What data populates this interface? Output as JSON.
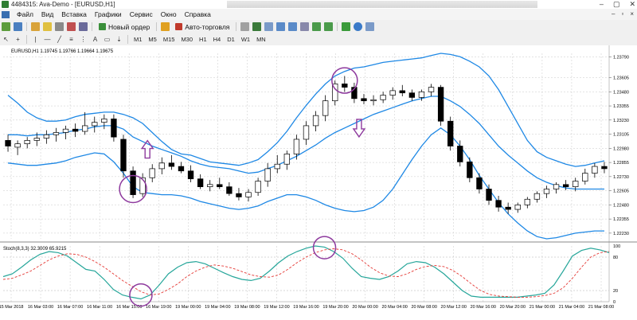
{
  "window": {
    "title": "4484315: Ava-Demo - [EURUSD,H1]",
    "controls": [
      "–",
      "▢",
      "✕"
    ]
  },
  "menu": {
    "items": [
      "Файл",
      "Вид",
      "Вставка",
      "Графики",
      "Сервис",
      "Окно",
      "Справка"
    ],
    "mdi_controls": [
      "–",
      "▫",
      "×"
    ]
  },
  "toolbar": {
    "new_order_label": "Новый ордер",
    "autotrade_label": "Авто-торговля",
    "icons": [
      "new-chart-icon",
      "profiles-icon",
      "market-watch-icon",
      "data-window-icon",
      "navigator-icon",
      "terminal-icon",
      "tester-icon",
      "metaeditor-icon",
      "bar-chart-icon",
      "candlestick-icon",
      "line-chart-icon",
      "zoom-in-icon",
      "zoom-out-icon",
      "tile-icon",
      "autoscroll-icon",
      "chart-shift-icon",
      "indicators-icon",
      "periods-icon",
      "templates-icon",
      "cursor-icon",
      "crosshair-icon",
      "vertical-line-icon",
      "horizontal-line-icon",
      "trendline-icon",
      "equidistant-channel-icon",
      "fibonacci-icon",
      "text-icon",
      "text-label-icon",
      "arrows-icon"
    ],
    "timeframes": [
      "M1",
      "M5",
      "M15",
      "M30",
      "H1",
      "H4",
      "D1",
      "W1",
      "MN"
    ],
    "active_timeframe": "H1"
  },
  "chart": {
    "header": "EURUSD,H1  1.19745 1.19766 1.19664 1.19675",
    "indicator_label": "Stoch(8,3,3) 32.3009 65.9215",
    "colors": {
      "bull": "#ffffff",
      "bear": "#000000",
      "bands": "#1e88e5",
      "stoch_main": "#26a69a",
      "stoch_signal": "#e53935",
      "annotation": "#8e3a9e",
      "grid": "#c8c8c8"
    }
  },
  "chart_data": {
    "type": "candlestick",
    "symbol": "EURUSD",
    "timeframe": "H1",
    "price_axis_ticks": [
      "1.23790",
      "1.23605",
      "1.23480",
      "1.23355",
      "1.23230",
      "1.23105",
      "1.22980",
      "1.22855",
      "1.22730",
      "1.22605",
      "1.22480",
      "1.22355",
      "1.22230"
    ],
    "ylim": [
      1.2218,
      1.2382
    ],
    "stoch_axis_ticks": [
      "100",
      "80",
      "20",
      "0"
    ],
    "time_axis_labels": [
      "15 Mar 2018",
      "16 Mar 03:00",
      "16 Mar 07:00",
      "16 Mar 11:00",
      "16 Mar 15:00",
      "16 Mar 19:00",
      "19 Mar 00:00",
      "19 Mar 04:00",
      "19 Mar 08:00",
      "19 Mar 12:00",
      "19 Mar 16:00",
      "19 Mar 20:00",
      "20 Mar 00:00",
      "20 Mar 04:00",
      "20 Mar 08:00",
      "20 Mar 12:00",
      "20 Mar 16:00",
      "20 Mar 20:00",
      "21 Mar 00:00",
      "21 Mar 04:00",
      "21 Mar 08:00"
    ],
    "candles": [
      {
        "o": 1.2305,
        "h": 1.231,
        "l": 1.2295,
        "c": 1.23
      },
      {
        "o": 1.2299,
        "h": 1.2305,
        "l": 1.2292,
        "c": 1.2302
      },
      {
        "o": 1.2302,
        "h": 1.2308,
        "l": 1.2298,
        "c": 1.2305
      },
      {
        "o": 1.2305,
        "h": 1.2312,
        "l": 1.23,
        "c": 1.2307
      },
      {
        "o": 1.2307,
        "h": 1.2314,
        "l": 1.2302,
        "c": 1.231
      },
      {
        "o": 1.231,
        "h": 1.2316,
        "l": 1.2304,
        "c": 1.2312
      },
      {
        "o": 1.2312,
        "h": 1.2318,
        "l": 1.2306,
        "c": 1.2315
      },
      {
        "o": 1.2315,
        "h": 1.232,
        "l": 1.2308,
        "c": 1.2313
      },
      {
        "o": 1.2313,
        "h": 1.233,
        "l": 1.231,
        "c": 1.2318
      },
      {
        "o": 1.2318,
        "h": 1.2326,
        "l": 1.2312,
        "c": 1.2321
      },
      {
        "o": 1.2321,
        "h": 1.2328,
        "l": 1.2315,
        "c": 1.2324
      },
      {
        "o": 1.2324,
        "h": 1.2328,
        "l": 1.2304,
        "c": 1.2308
      },
      {
        "o": 1.2306,
        "h": 1.231,
        "l": 1.2272,
        "c": 1.2278
      },
      {
        "o": 1.2278,
        "h": 1.2282,
        "l": 1.2254,
        "c": 1.2257
      },
      {
        "o": 1.2258,
        "h": 1.2276,
        "l": 1.2255,
        "c": 1.2272
      },
      {
        "o": 1.2272,
        "h": 1.2284,
        "l": 1.2268,
        "c": 1.228
      },
      {
        "o": 1.228,
        "h": 1.229,
        "l": 1.2275,
        "c": 1.2285
      },
      {
        "o": 1.2285,
        "h": 1.2292,
        "l": 1.2279,
        "c": 1.2282
      },
      {
        "o": 1.2282,
        "h": 1.2286,
        "l": 1.2276,
        "c": 1.2278
      },
      {
        "o": 1.2278,
        "h": 1.2283,
        "l": 1.2268,
        "c": 1.2271
      },
      {
        "o": 1.2271,
        "h": 1.2275,
        "l": 1.2262,
        "c": 1.2264
      },
      {
        "o": 1.2264,
        "h": 1.227,
        "l": 1.226,
        "c": 1.2266
      },
      {
        "o": 1.2266,
        "h": 1.2272,
        "l": 1.2262,
        "c": 1.2264
      },
      {
        "o": 1.2264,
        "h": 1.2268,
        "l": 1.2256,
        "c": 1.2258
      },
      {
        "o": 1.2258,
        "h": 1.2263,
        "l": 1.2252,
        "c": 1.2255
      },
      {
        "o": 1.2255,
        "h": 1.2262,
        "l": 1.2251,
        "c": 1.2259
      },
      {
        "o": 1.2259,
        "h": 1.2272,
        "l": 1.2256,
        "c": 1.2269
      },
      {
        "o": 1.2269,
        "h": 1.2285,
        "l": 1.2264,
        "c": 1.228
      },
      {
        "o": 1.228,
        "h": 1.2292,
        "l": 1.2276,
        "c": 1.2284
      },
      {
        "o": 1.2284,
        "h": 1.2296,
        "l": 1.2279,
        "c": 1.2293
      },
      {
        "o": 1.2293,
        "h": 1.231,
        "l": 1.2288,
        "c": 1.2306
      },
      {
        "o": 1.2306,
        "h": 1.2322,
        "l": 1.2301,
        "c": 1.2318
      },
      {
        "o": 1.2318,
        "h": 1.2331,
        "l": 1.2313,
        "c": 1.2327
      },
      {
        "o": 1.2327,
        "h": 1.2345,
        "l": 1.2322,
        "c": 1.234
      },
      {
        "o": 1.234,
        "h": 1.2358,
        "l": 1.2336,
        "c": 1.2355
      },
      {
        "o": 1.2355,
        "h": 1.2362,
        "l": 1.2348,
        "c": 1.2352
      },
      {
        "o": 1.2352,
        "h": 1.2356,
        "l": 1.2338,
        "c": 1.2342
      },
      {
        "o": 1.2342,
        "h": 1.2346,
        "l": 1.2337,
        "c": 1.234
      },
      {
        "o": 1.234,
        "h": 1.2345,
        "l": 1.2336,
        "c": 1.2341
      },
      {
        "o": 1.2341,
        "h": 1.2348,
        "l": 1.2338,
        "c": 1.2345
      },
      {
        "o": 1.2345,
        "h": 1.2352,
        "l": 1.2341,
        "c": 1.2349
      },
      {
        "o": 1.2349,
        "h": 1.2354,
        "l": 1.2344,
        "c": 1.2347
      },
      {
        "o": 1.2347,
        "h": 1.235,
        "l": 1.234,
        "c": 1.2343
      },
      {
        "o": 1.2343,
        "h": 1.235,
        "l": 1.234,
        "c": 1.2348
      },
      {
        "o": 1.2348,
        "h": 1.2355,
        "l": 1.2344,
        "c": 1.2352
      },
      {
        "o": 1.2352,
        "h": 1.2354,
        "l": 1.2318,
        "c": 1.2322
      },
      {
        "o": 1.2322,
        "h": 1.2326,
        "l": 1.2296,
        "c": 1.23
      },
      {
        "o": 1.23,
        "h": 1.2305,
        "l": 1.2282,
        "c": 1.2286
      },
      {
        "o": 1.2286,
        "h": 1.229,
        "l": 1.2268,
        "c": 1.2272
      },
      {
        "o": 1.2272,
        "h": 1.2276,
        "l": 1.2258,
        "c": 1.2262
      },
      {
        "o": 1.2262,
        "h": 1.2266,
        "l": 1.2248,
        "c": 1.2252
      },
      {
        "o": 1.2252,
        "h": 1.2256,
        "l": 1.2242,
        "c": 1.2246
      },
      {
        "o": 1.2246,
        "h": 1.225,
        "l": 1.224,
        "c": 1.2244
      },
      {
        "o": 1.2244,
        "h": 1.225,
        "l": 1.2241,
        "c": 1.2248
      },
      {
        "o": 1.2248,
        "h": 1.2255,
        "l": 1.2245,
        "c": 1.2253
      },
      {
        "o": 1.2253,
        "h": 1.226,
        "l": 1.225,
        "c": 1.2258
      },
      {
        "o": 1.2258,
        "h": 1.2265,
        "l": 1.2254,
        "c": 1.2262
      },
      {
        "o": 1.2262,
        "h": 1.2268,
        "l": 1.2258,
        "c": 1.2266
      },
      {
        "o": 1.2266,
        "h": 1.227,
        "l": 1.2261,
        "c": 1.2264
      },
      {
        "o": 1.2264,
        "h": 1.2272,
        "l": 1.226,
        "c": 1.2269
      },
      {
        "o": 1.2269,
        "h": 1.228,
        "l": 1.2266,
        "c": 1.2276
      },
      {
        "o": 1.2276,
        "h": 1.2285,
        "l": 1.2272,
        "c": 1.2282
      },
      {
        "o": 1.2282,
        "h": 1.2286,
        "l": 1.2276,
        "c": 1.228
      }
    ],
    "bollinger": {
      "upper": [
        1.2345,
        1.2338,
        1.233,
        1.2325,
        1.2322,
        1.2322,
        1.2323,
        1.2326,
        1.2328,
        1.2329,
        1.233,
        1.233,
        1.2328,
        1.2325,
        1.232,
        1.2312,
        1.2304,
        1.2297,
        1.2293,
        1.2292,
        1.2289,
        1.2286,
        1.2285,
        1.2284,
        1.2283,
        1.2285,
        1.2288,
        1.2295,
        1.2303,
        1.2313,
        1.2325,
        1.2336,
        1.2346,
        1.2355,
        1.2362,
        1.2366,
        1.2369,
        1.237,
        1.2372,
        1.2374,
        1.2375,
        1.2376,
        1.2377,
        1.2378,
        1.238,
        1.2382,
        1.2381,
        1.2379,
        1.2375,
        1.237,
        1.2362,
        1.235,
        1.2335,
        1.232,
        1.2305,
        1.2295,
        1.229,
        1.2287,
        1.2284,
        1.2282,
        1.2283,
        1.2285,
        1.2287
      ],
      "middle": [
        1.231,
        1.231,
        1.2309,
        1.231,
        1.231,
        1.2311,
        1.2312,
        1.2314,
        1.2315,
        1.2317,
        1.2318,
        1.2318,
        1.2315,
        1.2308,
        1.2304,
        1.23,
        1.2297,
        1.2294,
        1.2291,
        1.2287,
        1.2284,
        1.2282,
        1.2281,
        1.228,
        1.2278,
        1.2276,
        1.2277,
        1.228,
        1.2283,
        1.2287,
        1.2291,
        1.2296,
        1.2301,
        1.2307,
        1.2312,
        1.2316,
        1.232,
        1.2324,
        1.2328,
        1.2331,
        1.2334,
        1.2337,
        1.234,
        1.2342,
        1.2344,
        1.2344,
        1.234,
        1.2335,
        1.2328,
        1.232,
        1.231,
        1.23,
        1.2292,
        1.2285,
        1.2278,
        1.2272,
        1.2268,
        1.2265,
        1.2263,
        1.2262,
        1.2262,
        1.2262,
        1.2262
      ],
      "lower": [
        1.2285,
        1.2284,
        1.2283,
        1.2283,
        1.2284,
        1.2285,
        1.2287,
        1.229,
        1.2292,
        1.2294,
        1.2293,
        1.2286,
        1.2276,
        1.2264,
        1.2259,
        1.2258,
        1.2257,
        1.2257,
        1.2256,
        1.2254,
        1.2251,
        1.2249,
        1.2247,
        1.2245,
        1.2244,
        1.2245,
        1.2247,
        1.2251,
        1.2254,
        1.2257,
        1.2257,
        1.2255,
        1.2252,
        1.2248,
        1.2245,
        1.2243,
        1.2242,
        1.2243,
        1.2246,
        1.2252,
        1.2262,
        1.2275,
        1.2288,
        1.23,
        1.231,
        1.2316,
        1.231,
        1.23,
        1.2288,
        1.2274,
        1.2262,
        1.225,
        1.224,
        1.2232,
        1.2225,
        1.222,
        1.2218,
        1.2219,
        1.2221,
        1.2223,
        1.2224,
        1.2225,
        1.2225
      ]
    },
    "stochastic": {
      "main": [
        45,
        50,
        62,
        75,
        85,
        90,
        88,
        82,
        70,
        58,
        55,
        40,
        22,
        12,
        8,
        5,
        12,
        30,
        50,
        62,
        70,
        72,
        68,
        60,
        52,
        45,
        40,
        38,
        42,
        55,
        70,
        82,
        90,
        96,
        100,
        98,
        90,
        78,
        60,
        45,
        42,
        40,
        45,
        55,
        68,
        72,
        70,
        62,
        50,
        35,
        20,
        10,
        8,
        8,
        8,
        8,
        8,
        10,
        12,
        15,
        30,
        55,
        82,
        92,
        96,
        93,
        88
      ],
      "signal": [
        40,
        42,
        48,
        55,
        65,
        75,
        82,
        86,
        85,
        80,
        72,
        62,
        50,
        38,
        28,
        18,
        12,
        14,
        22,
        32,
        45,
        55,
        62,
        66,
        64,
        60,
        54,
        48,
        45,
        44,
        48,
        58,
        70,
        80,
        88,
        93,
        95,
        93,
        86,
        75,
        62,
        52,
        46,
        45,
        50,
        58,
        63,
        65,
        63,
        56,
        45,
        32,
        20,
        13,
        10,
        9,
        8,
        8,
        9,
        11,
        15,
        25,
        42,
        62,
        80,
        88,
        90
      ]
    }
  },
  "annotations": [
    "circle-low-candle",
    "arrow-up",
    "circle-high-candle",
    "arrow-down",
    "circle-stoch-low",
    "circle-stoch-high"
  ]
}
